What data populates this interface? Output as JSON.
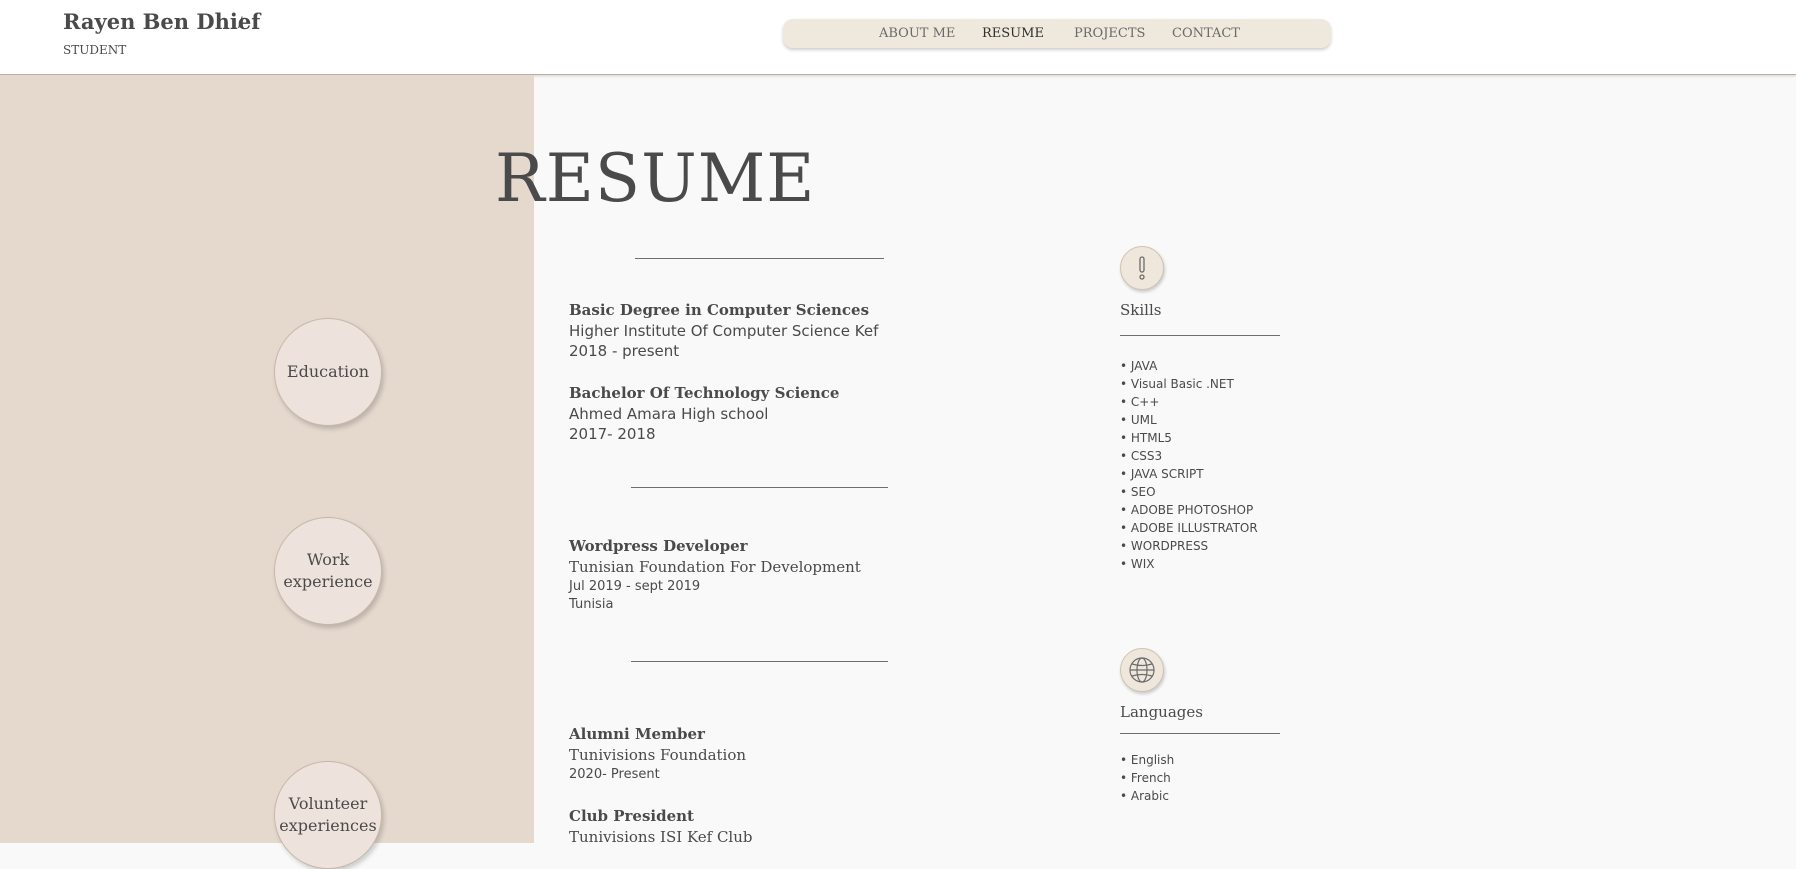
{
  "header": {
    "name": "Rayen Ben Dhief",
    "slash": "/",
    "subtitle": "STUDENT"
  },
  "nav": {
    "items": [
      {
        "label": "ABOUT ME",
        "active": false
      },
      {
        "label": "RESUME",
        "active": true
      },
      {
        "label": "PROJECTS",
        "active": false
      },
      {
        "label": "CONTACT",
        "active": false
      }
    ]
  },
  "page_title": "RESUME",
  "sections": {
    "education": {
      "label": "Education",
      "entries": [
        {
          "title": "Basic Degree in Computer Sciences",
          "org": "Higher Institute Of Computer Science Kef",
          "dates": "2018 - present"
        },
        {
          "title": "Bachelor Of Technology Science",
          "org": "Ahmed Amara High school",
          "dates": "2017- 2018"
        }
      ]
    },
    "work": {
      "label_line1": "Work",
      "label_line2": "experience",
      "entries": [
        {
          "title": "Wordpress Developer",
          "org": "Tunisian Foundation For Development",
          "dates": "Jul 2019 - sept 2019",
          "location": "Tunisia"
        }
      ]
    },
    "volunteer": {
      "label_line1": "Volunteer",
      "label_line2": "experiences",
      "entries": [
        {
          "title": "Alumni Member",
          "org": "Tunivisions Foundation",
          "dates": "2020- Present"
        },
        {
          "title": "Club President",
          "org": "Tunivisions ISI Kef Club"
        }
      ]
    }
  },
  "skills": {
    "icon": "exclamation-icon",
    "heading": "Skills",
    "items": [
      "• JAVA",
      "• Visual Basic .NET",
      "• C++",
      "• UML",
      "• HTML5",
      "• CSS3",
      "• JAVA SCRIPT",
      "• SEO",
      "• ADOBE PHOTOSHOP",
      "• ADOBE ILLUSTRATOR",
      "• WORDPRESS",
      "• WIX"
    ]
  },
  "languages": {
    "icon": "globe-icon",
    "heading": "Languages",
    "items": [
      "• English",
      "• French",
      "• Arabic"
    ]
  },
  "colors": {
    "left_panel": "#e5d9ce",
    "nav_bg": "#efe9dd",
    "content_bg": "#f9f9f9",
    "text": "#4a4a4a"
  }
}
